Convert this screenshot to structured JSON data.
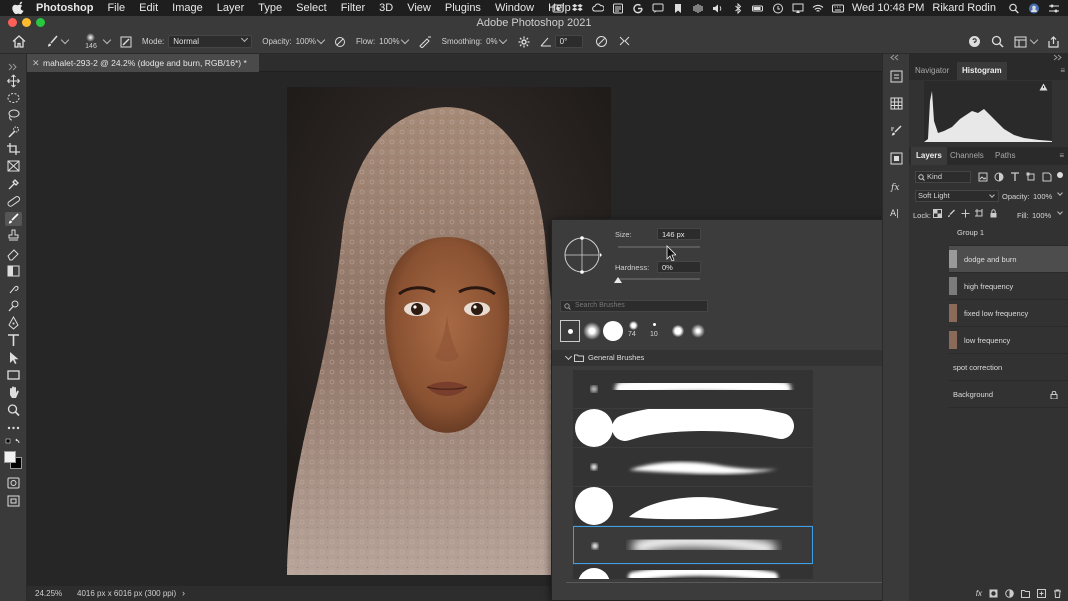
{
  "menubar": {
    "app_name": "Photoshop",
    "items": [
      "File",
      "Edit",
      "Image",
      "Layer",
      "Type",
      "Select",
      "Filter",
      "3D",
      "View",
      "Plugins",
      "Window",
      "Help"
    ],
    "clock": "Wed 10:48 PM",
    "user": "Rikard Rodin"
  },
  "window": {
    "title": "Adobe Photoshop 2021"
  },
  "options": {
    "brush_size": "146",
    "mode_label": "Mode:",
    "mode_value": "Normal",
    "opacity_label": "Opacity:",
    "opacity_value": "100%",
    "flow_label": "Flow:",
    "flow_value": "100%",
    "smoothing_label": "Smoothing:",
    "smoothing_value": "0%",
    "angle_value": "0°"
  },
  "document": {
    "tab_label": "mahalet-293-2 @ 24.2% (dodge and burn, RGB/16*) *",
    "zoom": "24.25%",
    "dimensions": "4016 px x 6016 px (300 ppi)"
  },
  "brush_picker": {
    "size_label": "Size:",
    "size_value": "146 px",
    "size_fraction": 0.6,
    "hardness_label": "Hardness:",
    "hardness_value": "0%",
    "hardness_fraction": 0.0,
    "search_placeholder": "Search Brushes",
    "recent_sizes": [
      "74",
      "10"
    ],
    "folder_name": "General Brushes"
  },
  "panels": {
    "nav_tabs": [
      "Navigator",
      "Histogram"
    ],
    "active_nav_tab": "Histogram",
    "layer_tabs": [
      "Layers",
      "Channels",
      "Paths"
    ],
    "kind_filter": "Kind",
    "blend_mode": "Soft Light",
    "opacity_label": "Opacity:",
    "opacity_value": "100%",
    "lock_label": "Lock:",
    "fill_label": "Fill:",
    "fill_value": "100%",
    "layers": [
      {
        "name": "Group 1"
      },
      {
        "name": "dodge and burn"
      },
      {
        "name": "high frequency"
      },
      {
        "name": "fixed low frequency"
      },
      {
        "name": "low frequency"
      },
      {
        "name": "spot correction"
      },
      {
        "name": "Background"
      }
    ]
  },
  "colors": {
    "accent": "#3aa0e8",
    "panel_bg": "#323232",
    "canvas_bg": "#262626"
  }
}
